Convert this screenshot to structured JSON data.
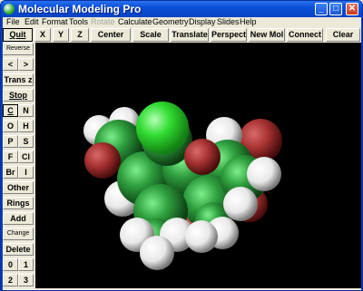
{
  "window": {
    "title": "Molecular Modeling Pro"
  },
  "menu": [
    {
      "label": "File",
      "enabled": true
    },
    {
      "label": "Edit",
      "enabled": true
    },
    {
      "label": "Format",
      "enabled": true
    },
    {
      "label": "Tools",
      "enabled": true
    },
    {
      "label": "Rotate",
      "enabled": false
    },
    {
      "label": "Calculate",
      "enabled": true
    },
    {
      "label": "Geometry",
      "enabled": true
    },
    {
      "label": "Display",
      "enabled": true
    },
    {
      "label": "Slides",
      "enabled": true
    },
    {
      "label": "Help",
      "enabled": true
    }
  ],
  "toolbar": [
    "Quit",
    "X",
    "Y",
    "Z",
    "Center",
    "Scale",
    "Translate",
    "Perspect",
    "New Mol",
    "Connect",
    "Clear"
  ],
  "sidebar": {
    "reverse": "Reverse",
    "arrow_left": "<",
    "arrow_right": ">",
    "trans_z": "Trans z",
    "stop": "Stop",
    "elements": [
      "C",
      "N",
      "O",
      "H",
      "P",
      "S",
      "F",
      "Cl",
      "Br",
      "I"
    ],
    "selected_element": "C",
    "other": "Other",
    "rings": "Rings",
    "add": "Add",
    "change": "Change",
    "delete": "Delete",
    "digits": [
      "0",
      "1",
      "2",
      "3"
    ],
    "plus": "+",
    "minus": "-"
  },
  "atom_colors": {
    "carbon": "#2e9e3e",
    "hydrogen": "#ffffff",
    "oxygen": "#a83232",
    "chlorine": "#33dd33"
  },
  "viewport_background": "#000000"
}
